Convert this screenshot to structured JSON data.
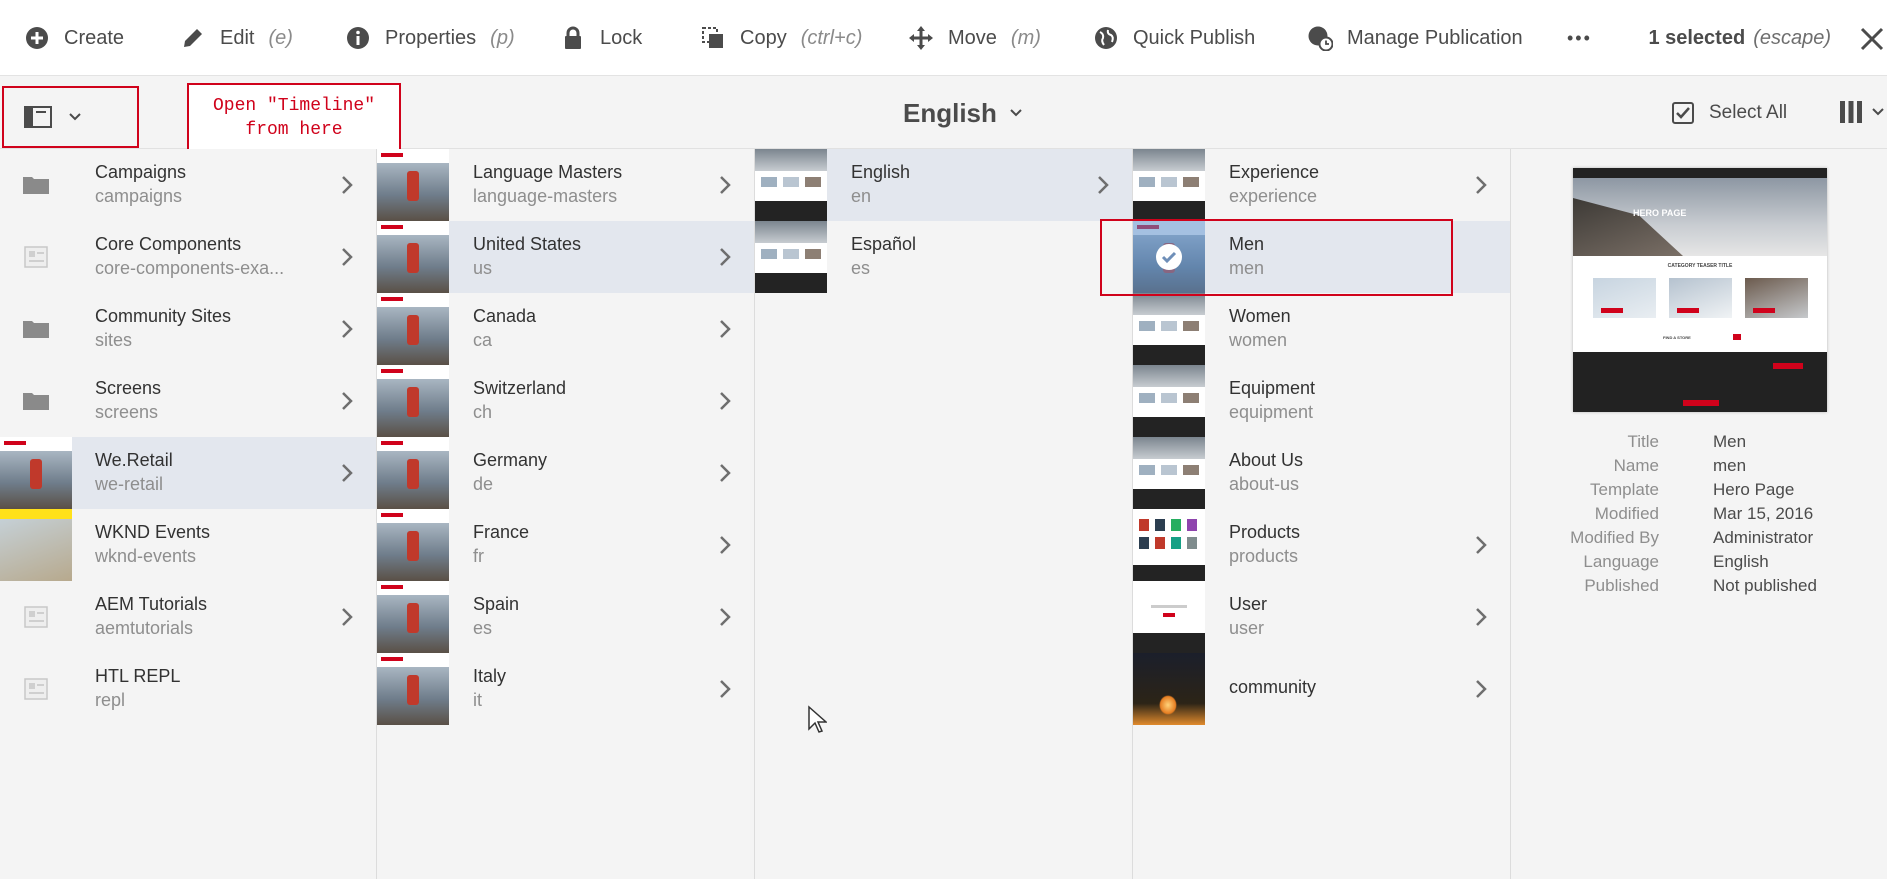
{
  "toolbar": {
    "create": "Create",
    "edit": "Edit",
    "edit_hint": "(e)",
    "properties": "Properties",
    "properties_hint": "(p)",
    "lock": "Lock",
    "copy": "Copy",
    "copy_hint": "(ctrl+c)",
    "move": "Move",
    "move_hint": "(m)",
    "quick_publish": "Quick Publish",
    "manage_publication": "Manage Publication",
    "more": "•••",
    "selected": "1 selected",
    "selected_hint": "(escape)"
  },
  "subbar": {
    "annotation": "Open \"Timeline\"\nfrom here",
    "breadcrumb": "English",
    "select_all": "Select All"
  },
  "columns": [
    {
      "items": [
        {
          "title": "Campaigns",
          "sub": "campaigns",
          "icon": "folder-icon",
          "chevron": true
        },
        {
          "title": "Core Components",
          "sub": "core-components-exa...",
          "icon": "page-icon",
          "chevron": true
        },
        {
          "title": "Community Sites",
          "sub": "sites",
          "icon": "folder-icon",
          "chevron": true
        },
        {
          "title": "Screens",
          "sub": "screens",
          "icon": "folder-icon",
          "chevron": true
        },
        {
          "title": "We.Retail",
          "sub": "we-retail",
          "icon": "thumbnail",
          "chevron": true,
          "active": true
        },
        {
          "title": "WKND Events",
          "sub": "wknd-events",
          "icon": "thumbnail",
          "chevron": false
        },
        {
          "title": "AEM Tutorials",
          "sub": "aemtutorials",
          "icon": "page-icon",
          "chevron": true
        },
        {
          "title": "HTL REPL",
          "sub": "repl",
          "icon": "page-icon",
          "chevron": false
        }
      ]
    },
    {
      "items": [
        {
          "title": "Language Masters",
          "sub": "language-masters",
          "chevron": true
        },
        {
          "title": "United States",
          "sub": "us",
          "chevron": true,
          "active": true
        },
        {
          "title": "Canada",
          "sub": "ca",
          "chevron": true
        },
        {
          "title": "Switzerland",
          "sub": "ch",
          "chevron": true
        },
        {
          "title": "Germany",
          "sub": "de",
          "chevron": true
        },
        {
          "title": "France",
          "sub": "fr",
          "chevron": true
        },
        {
          "title": "Spain",
          "sub": "es",
          "chevron": true
        },
        {
          "title": "Italy",
          "sub": "it",
          "chevron": true
        }
      ]
    },
    {
      "items": [
        {
          "title": "English",
          "sub": "en",
          "chevron": true,
          "active": true
        },
        {
          "title": "Español",
          "sub": "es",
          "chevron": false
        }
      ]
    },
    {
      "items": [
        {
          "title": "Experience",
          "sub": "experience",
          "chevron": true
        },
        {
          "title": "Men",
          "sub": "men",
          "chevron": false,
          "active": true,
          "checked": true
        },
        {
          "title": "Women",
          "sub": "women",
          "chevron": false
        },
        {
          "title": "Equipment",
          "sub": "equipment",
          "chevron": false
        },
        {
          "title": "About Us",
          "sub": "about-us",
          "chevron": false
        },
        {
          "title": "Products",
          "sub": "products",
          "chevron": true
        },
        {
          "title": "User",
          "sub": "user",
          "chevron": true
        },
        {
          "title": "community",
          "sub": "",
          "chevron": true
        }
      ]
    }
  ],
  "detail": {
    "preview_text": "HERO PAGE",
    "teaser_title": "CATEGORY TEASER TITLE",
    "find_store": "FIND A STORE",
    "meta": [
      {
        "label": "Title",
        "value": "Men"
      },
      {
        "label": "Name",
        "value": "men"
      },
      {
        "label": "Template",
        "value": "Hero Page"
      },
      {
        "label": "Modified",
        "value": "Mar 15, 2016"
      },
      {
        "label": "Modified By",
        "value": "Administrator"
      },
      {
        "label": "Language",
        "value": "English"
      },
      {
        "label": "Published",
        "value": "Not published"
      }
    ]
  },
  "colors": {
    "accent_red": "#d0021b",
    "active_row": "#e3e7ee",
    "background": "#f4f4f4"
  }
}
